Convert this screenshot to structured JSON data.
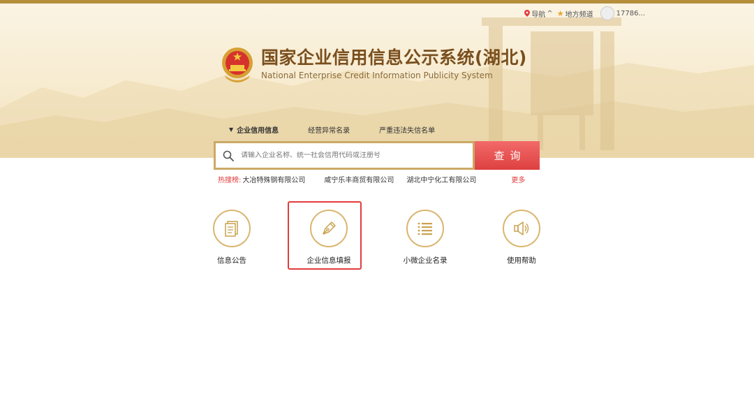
{
  "topnav": {
    "nav_label": "导航",
    "nav_caret": "^",
    "channel_label": "地方频道",
    "user_label": "17786..."
  },
  "header": {
    "title_cn": "国家企业信用信息公示系统(湖北)",
    "title_en": "National Enterprise Credit Information Publicity System"
  },
  "tabs": [
    {
      "label": "企业信用信息",
      "active": true
    },
    {
      "label": "经营异常名录",
      "active": false
    },
    {
      "label": "严重违法失信名单",
      "active": false
    }
  ],
  "search": {
    "placeholder": "请输入企业名称、统一社会信用代码或注册号",
    "button_label": "查询"
  },
  "hot": {
    "label": "热搜榜:",
    "items": [
      "大冶特殊钢有限公司",
      "咸宁乐丰商贸有限公司",
      "湖北中宁化工有限公司"
    ],
    "more": "更多"
  },
  "features": [
    {
      "label": "信息公告",
      "icon": "document-icon"
    },
    {
      "label": "企业信息填报",
      "icon": "pen-icon"
    },
    {
      "label": "小微企业名录",
      "icon": "list-icon"
    },
    {
      "label": "使用帮助",
      "icon": "speaker-icon"
    }
  ],
  "colors": {
    "gold": "#d9b66f",
    "brown": "#7a4f1e",
    "red": "#e23c3c",
    "stripe": "#b58f3c"
  }
}
